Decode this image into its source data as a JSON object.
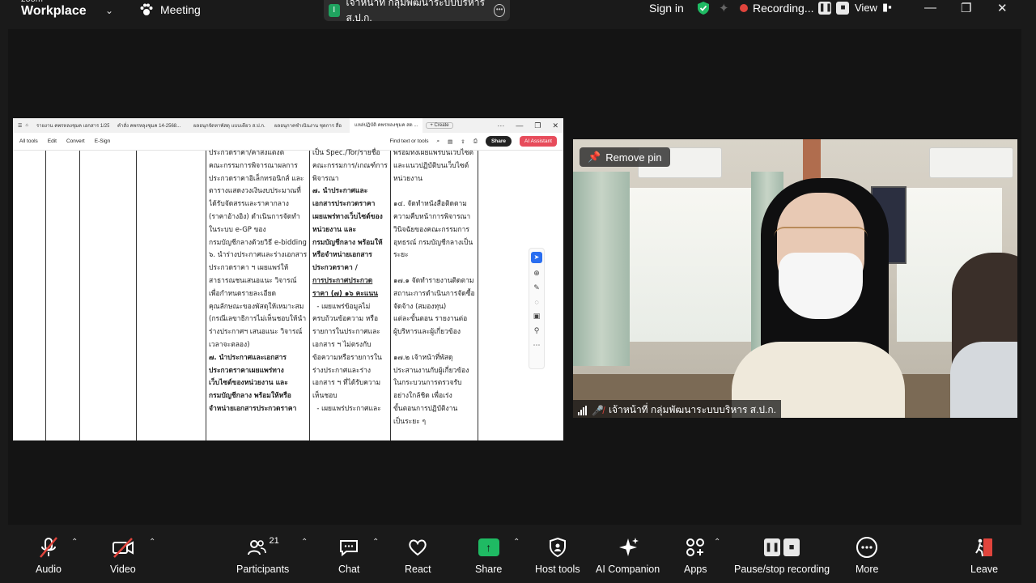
{
  "topbar": {
    "brand_small": "zoom",
    "brand": "Workplace",
    "meeting_label": "Meeting",
    "title_initial": "I",
    "meeting_title": "เจ้าหน้าที่ กลุ่มพัฒนาระบบบริหาร ส.ป.ก.",
    "signin": "Sign in",
    "recording": "Recording...",
    "view": "View"
  },
  "shared_screen": {
    "tabs": [
      "รายงาน คพรหลงชุมค เอกสาร 1/2568",
      "คำสั่ง คพรหลุงชุมค 14-2568...",
      "ผลอนุกจัดหาพัสดุ แบบเดียว ส.ป.ก. ...",
      "ผลอนุกาคชำเนินงาน ชุดการ สื่อ",
      "แหล่ปฏิบัติ คพรหลงชุมค สด ..."
    ],
    "new_tab": "+ Create",
    "menu": [
      "All tools",
      "Edit",
      "Convert",
      "E-Sign"
    ],
    "find": "Find text or tools",
    "share_btn": "Share",
    "ai_btn": "AI Assistant",
    "page_num": "7",
    "page_total": "20",
    "col1": [
      "ประกวดราคา/คาสงแตงต",
      "คณะกรรมการพิจารณาผลการ",
      "ประกวดราคาอิเล็กทรอนิกส์ และ",
      "ตารางแสดงวงเงินงบประมาณที่",
      "ได้รับจัดสรรและราคากลาง",
      "(ราคาอ้างอิง) ดำเนินการจัดทำ",
      "ในระบบ e-GP ของ",
      "กรมบัญชีกลางด้วยวิธี e-bidding",
      "๖. นำร่างประกาศและร่างเอกสาร",
      "ประกวดราคา ฯ เผยแพร่ให้",
      "สาธารณชนเสนอแนะ วิจารณ์",
      "เพื่อกำหนดรายละเอียด",
      "คุณลักษณะของพัสดุให้เหมาะสม",
      "(กรณีเลขาธิการไม่เห็นชอบให้นำ",
      "ร่างประกาศฯ เสนอแนะ วิจารณ์",
      "เวลาจะตลอง)",
      "๗. นำประกาศและเอกสาร",
      "ประกวดราคาเผยแพร่ทาง",
      "เว็บไซต์ของหน่วยงาน และ",
      "กรมบัญชีกลาง พร้อมให้หรือ",
      "จำหน่ายเอกสารประกวดราคา"
    ],
    "col2": [
      "เป็น Spec./Tor/รายชื่อ",
      "คณะกรรมการ/เกณฑ์การ",
      "พิจารณา",
      "๗. นำประกาศและ",
      "เอกสารประกวดราคา",
      "เผยแพร่ทางเว็บไซต์ของ",
      "หน่วยงาน และ",
      "กรมบัญชีกลาง พร้อมให้",
      "หรือจำหน่ายเอกสาร",
      "ประกวดราคา /",
      "การประกาศประกวด",
      "ราคา (๗) ๑๖ คะแนน",
      "  - เผยแพร่ข้อมูลไม่",
      "ครบถ้วนข้อความ หรือ",
      "รายการในประกาศและ",
      "เอกสาร ฯ ไม่ตรงกับ",
      "ข้อความหรือรายการใน",
      "ร่างประกาศและร่าง",
      "เอกสาร ฯ ที่ได้รับความ",
      "เห็นชอบ",
      "  - เผยแพร่ประกาศและ"
    ],
    "col3": [
      "พรอมทงเผยแพรบนเวบไซต",
      "และแนวปฏิบัติบนเว็บไซต์",
      "หน่วยงาน",
      "",
      "๑๔. จัดทำหนังสือติดตาม",
      "ความคืบหน้าการพิจารณา",
      "วินิจฉัยของคณะกรรมการ",
      "อุทธรณ์ กรมบัญชีกลางเป็น",
      "ระยะ",
      "",
      "๑๗.๑ จัดทำรายงานติดตาม",
      "สถานะการดำเนินการจัดซื้อ",
      "จัดจ้าง (สมองทุน)",
      "แต่ละขั้นตอน รายงานต่อ",
      "ผู้บริหารและผู้เกี่ยวข้อง",
      "",
      "๑๗.๒ เจ้าหน้าที่พัสดุ",
      "ประสานงานกับผู้เกี่ยวข้อง",
      "ในกระบวนการตรวจรับ",
      "อย่างใกล้ชิด เพื่อเร่ง",
      "ขั้นตอนการปฏิบัติงาน",
      "เป็นระยะ ๆ"
    ]
  },
  "video": {
    "remove_pin": "Remove pin",
    "participant_name": "เจ้าหน้าที่ กลุ่มพัฒนาระบบบริหาร ส.ป.ก."
  },
  "toolbar": {
    "audio": "Audio",
    "video": "Video",
    "participants": "Participants",
    "participants_count": "21",
    "chat": "Chat",
    "react": "React",
    "share": "Share",
    "host_tools": "Host tools",
    "ai_companion": "AI Companion",
    "apps": "Apps",
    "pause_stop": "Pause/stop recording",
    "more": "More",
    "leave": "Leave"
  },
  "colors": {
    "share_green": "#1fba63",
    "record_red": "#e0443c",
    "leave_red": "#e0443c",
    "background": "#1a1a1a"
  }
}
